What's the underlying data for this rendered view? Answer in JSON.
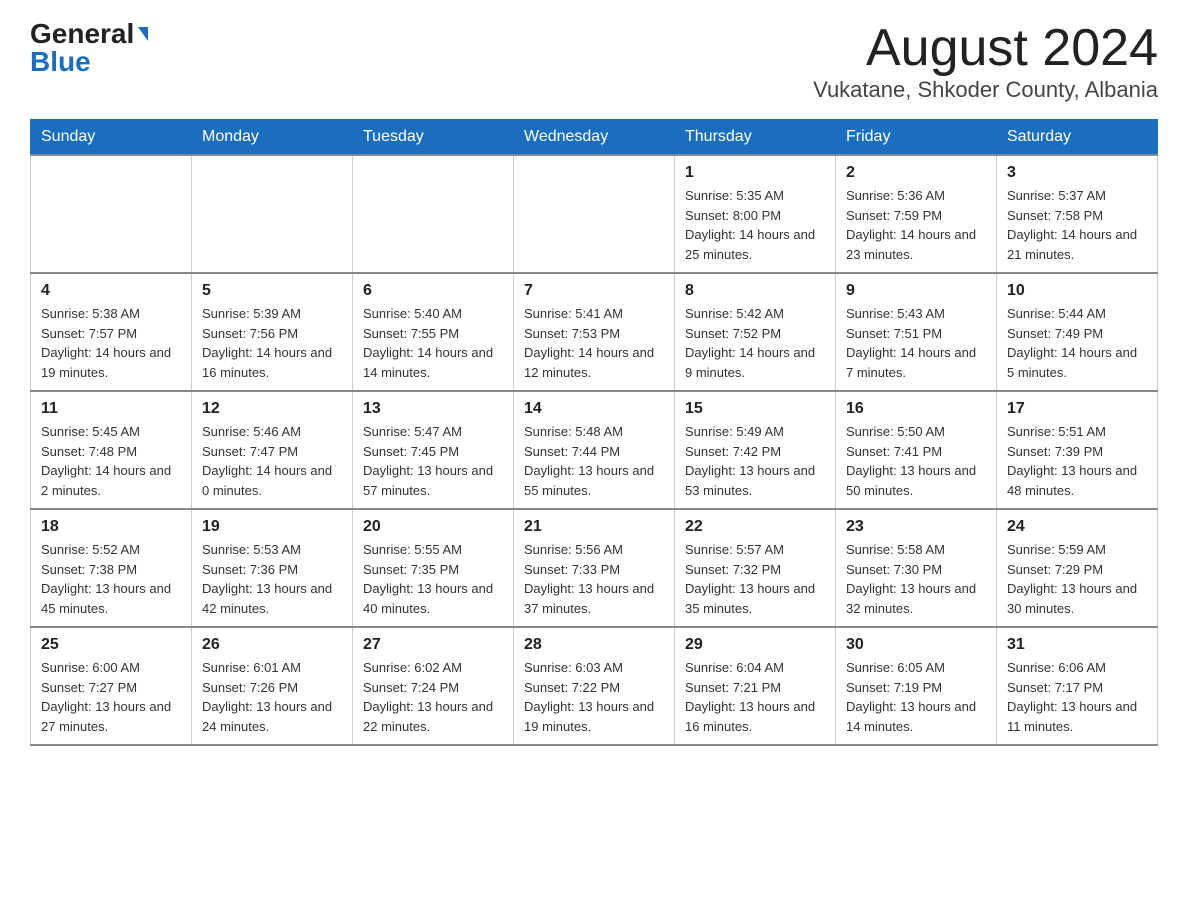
{
  "header": {
    "logo_general": "General",
    "logo_blue": "Blue",
    "month_title": "August 2024",
    "location": "Vukatane, Shkoder County, Albania"
  },
  "days_of_week": [
    "Sunday",
    "Monday",
    "Tuesday",
    "Wednesday",
    "Thursday",
    "Friday",
    "Saturday"
  ],
  "weeks": [
    [
      {
        "day": "",
        "info": ""
      },
      {
        "day": "",
        "info": ""
      },
      {
        "day": "",
        "info": ""
      },
      {
        "day": "",
        "info": ""
      },
      {
        "day": "1",
        "info": "Sunrise: 5:35 AM\nSunset: 8:00 PM\nDaylight: 14 hours and 25 minutes."
      },
      {
        "day": "2",
        "info": "Sunrise: 5:36 AM\nSunset: 7:59 PM\nDaylight: 14 hours and 23 minutes."
      },
      {
        "day": "3",
        "info": "Sunrise: 5:37 AM\nSunset: 7:58 PM\nDaylight: 14 hours and 21 minutes."
      }
    ],
    [
      {
        "day": "4",
        "info": "Sunrise: 5:38 AM\nSunset: 7:57 PM\nDaylight: 14 hours and 19 minutes."
      },
      {
        "day": "5",
        "info": "Sunrise: 5:39 AM\nSunset: 7:56 PM\nDaylight: 14 hours and 16 minutes."
      },
      {
        "day": "6",
        "info": "Sunrise: 5:40 AM\nSunset: 7:55 PM\nDaylight: 14 hours and 14 minutes."
      },
      {
        "day": "7",
        "info": "Sunrise: 5:41 AM\nSunset: 7:53 PM\nDaylight: 14 hours and 12 minutes."
      },
      {
        "day": "8",
        "info": "Sunrise: 5:42 AM\nSunset: 7:52 PM\nDaylight: 14 hours and 9 minutes."
      },
      {
        "day": "9",
        "info": "Sunrise: 5:43 AM\nSunset: 7:51 PM\nDaylight: 14 hours and 7 minutes."
      },
      {
        "day": "10",
        "info": "Sunrise: 5:44 AM\nSunset: 7:49 PM\nDaylight: 14 hours and 5 minutes."
      }
    ],
    [
      {
        "day": "11",
        "info": "Sunrise: 5:45 AM\nSunset: 7:48 PM\nDaylight: 14 hours and 2 minutes."
      },
      {
        "day": "12",
        "info": "Sunrise: 5:46 AM\nSunset: 7:47 PM\nDaylight: 14 hours and 0 minutes."
      },
      {
        "day": "13",
        "info": "Sunrise: 5:47 AM\nSunset: 7:45 PM\nDaylight: 13 hours and 57 minutes."
      },
      {
        "day": "14",
        "info": "Sunrise: 5:48 AM\nSunset: 7:44 PM\nDaylight: 13 hours and 55 minutes."
      },
      {
        "day": "15",
        "info": "Sunrise: 5:49 AM\nSunset: 7:42 PM\nDaylight: 13 hours and 53 minutes."
      },
      {
        "day": "16",
        "info": "Sunrise: 5:50 AM\nSunset: 7:41 PM\nDaylight: 13 hours and 50 minutes."
      },
      {
        "day": "17",
        "info": "Sunrise: 5:51 AM\nSunset: 7:39 PM\nDaylight: 13 hours and 48 minutes."
      }
    ],
    [
      {
        "day": "18",
        "info": "Sunrise: 5:52 AM\nSunset: 7:38 PM\nDaylight: 13 hours and 45 minutes."
      },
      {
        "day": "19",
        "info": "Sunrise: 5:53 AM\nSunset: 7:36 PM\nDaylight: 13 hours and 42 minutes."
      },
      {
        "day": "20",
        "info": "Sunrise: 5:55 AM\nSunset: 7:35 PM\nDaylight: 13 hours and 40 minutes."
      },
      {
        "day": "21",
        "info": "Sunrise: 5:56 AM\nSunset: 7:33 PM\nDaylight: 13 hours and 37 minutes."
      },
      {
        "day": "22",
        "info": "Sunrise: 5:57 AM\nSunset: 7:32 PM\nDaylight: 13 hours and 35 minutes."
      },
      {
        "day": "23",
        "info": "Sunrise: 5:58 AM\nSunset: 7:30 PM\nDaylight: 13 hours and 32 minutes."
      },
      {
        "day": "24",
        "info": "Sunrise: 5:59 AM\nSunset: 7:29 PM\nDaylight: 13 hours and 30 minutes."
      }
    ],
    [
      {
        "day": "25",
        "info": "Sunrise: 6:00 AM\nSunset: 7:27 PM\nDaylight: 13 hours and 27 minutes."
      },
      {
        "day": "26",
        "info": "Sunrise: 6:01 AM\nSunset: 7:26 PM\nDaylight: 13 hours and 24 minutes."
      },
      {
        "day": "27",
        "info": "Sunrise: 6:02 AM\nSunset: 7:24 PM\nDaylight: 13 hours and 22 minutes."
      },
      {
        "day": "28",
        "info": "Sunrise: 6:03 AM\nSunset: 7:22 PM\nDaylight: 13 hours and 19 minutes."
      },
      {
        "day": "29",
        "info": "Sunrise: 6:04 AM\nSunset: 7:21 PM\nDaylight: 13 hours and 16 minutes."
      },
      {
        "day": "30",
        "info": "Sunrise: 6:05 AM\nSunset: 7:19 PM\nDaylight: 13 hours and 14 minutes."
      },
      {
        "day": "31",
        "info": "Sunrise: 6:06 AM\nSunset: 7:17 PM\nDaylight: 13 hours and 11 minutes."
      }
    ]
  ]
}
